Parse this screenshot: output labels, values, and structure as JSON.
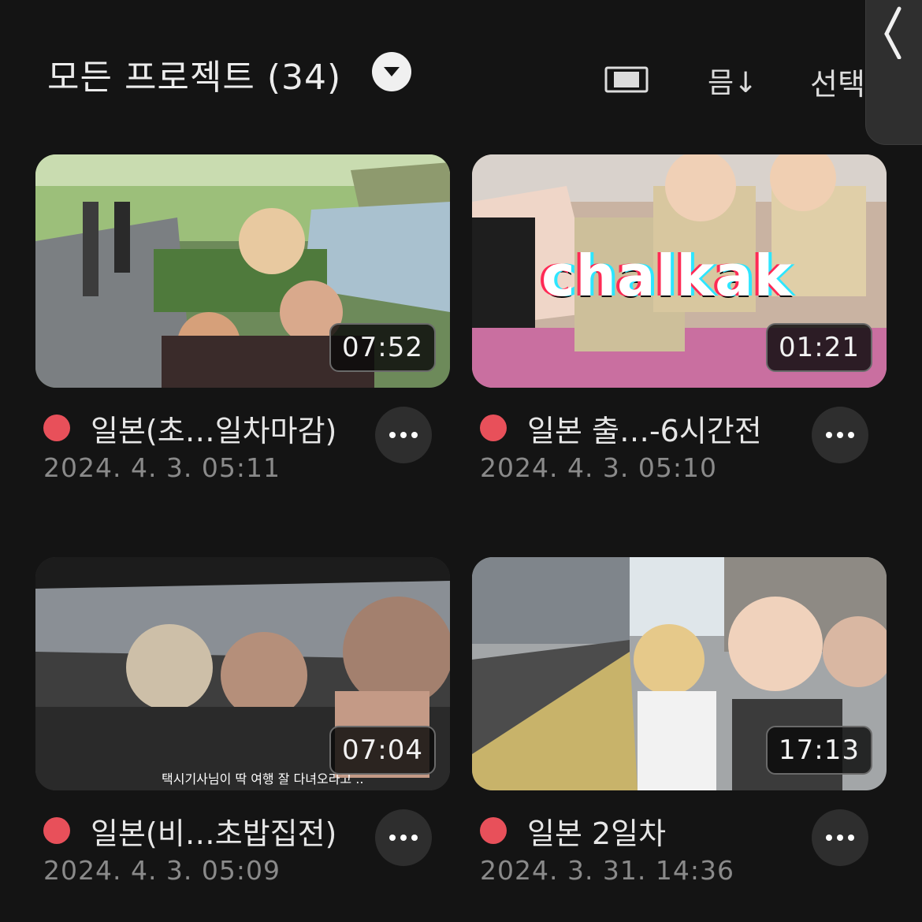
{
  "header": {
    "title": "모든 프로젝트 (34)",
    "sort_label": "믐↓",
    "select_label": "선택"
  },
  "colors": {
    "background": "#141414",
    "status_dot": "#e8505a"
  },
  "icons": [
    "chevron-down-icon",
    "aspect-ratio-icon",
    "sort-icon",
    "chevron-left-icon",
    "more-icon"
  ],
  "projects": [
    {
      "title": "일본(초…일차마감)",
      "date": "2024. 4. 3. 05:11",
      "duration": "07:52"
    },
    {
      "title": "일본 출…-6시간전",
      "date": "2024. 4. 3. 05:10",
      "duration": "01:21",
      "overlay_text": "chalkak"
    },
    {
      "title": "일본(비…초밥집전)",
      "date": "2024. 4. 3. 05:09",
      "duration": "07:04",
      "overlay_text": "택시기사님이 딱 여행 잘 다녀오라고 .."
    },
    {
      "title": "일본 2일차",
      "date": "2024. 3. 31. 14:36",
      "duration": "17:13"
    }
  ]
}
